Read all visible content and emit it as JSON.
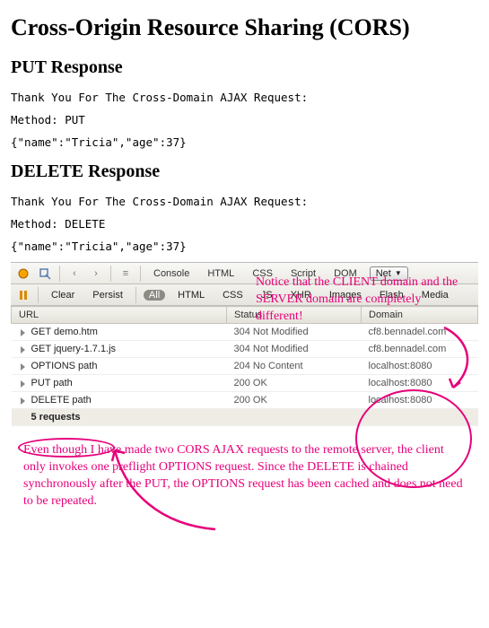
{
  "page": {
    "title": "Cross-Origin Resource Sharing (CORS)",
    "put": {
      "heading": "PUT Response",
      "thank": "Thank You For The Cross-Domain AJAX Request:",
      "method": "Method: PUT",
      "body": "{\"name\":\"Tricia\",\"age\":37}"
    },
    "del": {
      "heading": "DELETE Response",
      "thank": "Thank You For The Cross-Domain AJAX Request:",
      "method": "Method: DELETE",
      "body": "{\"name\":\"Tricia\",\"age\":37}"
    }
  },
  "devtools": {
    "tabs": {
      "console": "Console",
      "html": "HTML",
      "css": "CSS",
      "script": "Script",
      "dom": "DOM",
      "net": "Net"
    },
    "row2": {
      "clear": "Clear",
      "persist": "Persist",
      "all": "All",
      "html": "HTML",
      "css": "CSS",
      "js": "JS",
      "xhr": "XHR",
      "images": "Images",
      "flash": "Flash",
      "media": "Media"
    },
    "headers": {
      "url": "URL",
      "status": "Status",
      "domain": "Domain"
    },
    "rows": [
      {
        "url": "GET demo.htm",
        "status": "304 Not Modified",
        "domain": "cf8.bennadel.com"
      },
      {
        "url": "GET jquery-1.7.1.js",
        "status": "304 Not Modified",
        "domain": "cf8.bennadel.com"
      },
      {
        "url": "OPTIONS path",
        "status": "204 No Content",
        "domain": "localhost:8080"
      },
      {
        "url": "PUT path",
        "status": "200 OK",
        "domain": "localhost:8080"
      },
      {
        "url": "DELETE path",
        "status": "200 OK",
        "domain": "localhost:8080"
      }
    ],
    "footer": "5 requests"
  },
  "annotations": {
    "top": "Notice that the CLIENT domain and the SERVER domain are completely different!",
    "bottom": "Even though I have made two CORS AJAX requests to the remote server, the client only invokes one preflight OPTIONS request. Since the DELETE is chained synchronously after the PUT, the OPTIONS request has been cached and does not need to be repeated."
  }
}
